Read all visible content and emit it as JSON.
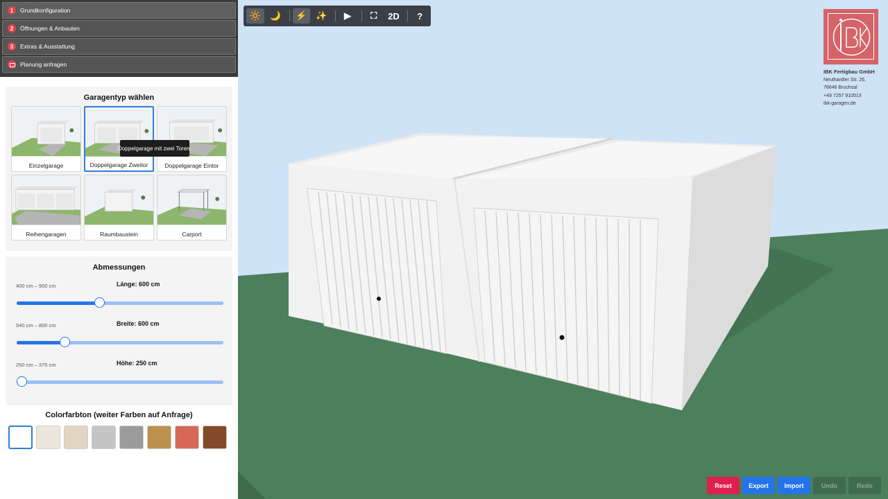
{
  "steps": [
    {
      "num": "1",
      "label": "Grundkonfiguration"
    },
    {
      "num": "2",
      "label": "Öffnungen & Anbauten"
    },
    {
      "num": "3",
      "label": "Extras & Ausstattung"
    },
    {
      "num": "",
      "label": "Planung anfragen"
    }
  ],
  "garage_type": {
    "title": "Garagentyp wählen",
    "items": [
      {
        "label": "Einzelgarage"
      },
      {
        "label": "Doppelgarage Zweitor"
      },
      {
        "label": "Doppelgarage Eintor"
      },
      {
        "label": "Reihengaragen"
      },
      {
        "label": "Raumbaustein"
      },
      {
        "label": "Carport"
      }
    ],
    "selected": "Doppelgarage Zweitor",
    "tooltip": "Doppelgarage mit zwei Toren."
  },
  "dimensions": {
    "title": "Abmessungen",
    "length": {
      "range": "400 cm – 900 cm",
      "value": "Länge:  600  cm",
      "fraction": 0.4
    },
    "width": {
      "range": "540 cm – 800 cm",
      "value": "Breite:  600  cm",
      "fraction": 0.231
    },
    "height": {
      "range": "250 cm – 375 cm",
      "value": "Höhe:  250  cm",
      "fraction": 0.0
    }
  },
  "color": {
    "title": "Colorfarbton (weiter Farben auf Anfrage)",
    "swatches": [
      "#ffffff",
      "#ede6de",
      "#e2d6c2",
      "#c5c5c5",
      "#9b9b9b",
      "#bc914e",
      "#d76858",
      "#844b2a"
    ],
    "selected": "#ffffff"
  },
  "toolbar": {
    "sun": "🔆",
    "moon": "🌙",
    "light": "⚡",
    "effects": "✨",
    "play": "▶",
    "fullscreen": "⛶",
    "mode_2d": "2D",
    "help": "?"
  },
  "company": {
    "name": "IBK Fertigbau GmbH",
    "street": "Neuthardter Str. 26,",
    "city": "76646 Bruchsal",
    "phone": "+49 7257 910513",
    "web": "ibk-garagen.de",
    "logo_text": "IBK"
  },
  "actions": {
    "reset": "Reset",
    "export": "Export",
    "import": "Import",
    "undo": "Undo",
    "redo": "Redo"
  },
  "scene_colors": {
    "sky": "#cfe3f7",
    "ground": "#4c7f5b",
    "garage": "#f2f2f2"
  }
}
